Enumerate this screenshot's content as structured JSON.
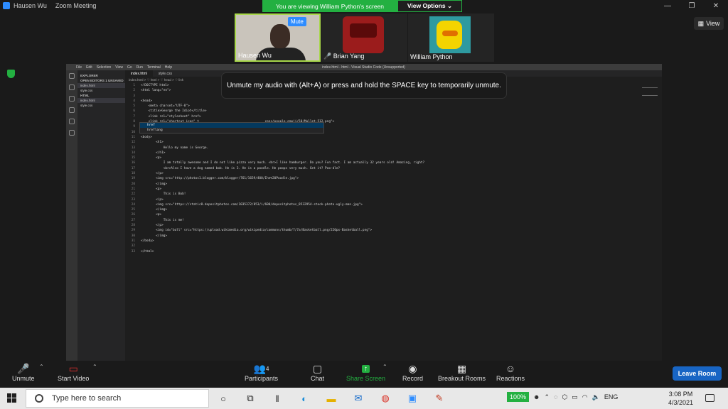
{
  "titlebar": {
    "user": "Hausen Wu",
    "app": "Zoom Meeting"
  },
  "banner": {
    "viewing": "You are viewing William Python's screen",
    "options": "View Options ⌄"
  },
  "view_button": "View",
  "participants": [
    {
      "name": "Hausen Wu",
      "mute_label": "Mute"
    },
    {
      "name": "Brian Yang"
    },
    {
      "name": "William Python"
    }
  ],
  "vscode": {
    "window_title": "index.html - html - Visual Studio Code (Unsupported)",
    "menu": [
      "File",
      "Edit",
      "Selection",
      "View",
      "Go",
      "Run",
      "Terminal",
      "Help"
    ],
    "explorer_label": "EXPLORER",
    "open_editors_label": "OPEN EDITORS",
    "unsaved_badge": "1 UNSAVED",
    "open_files": [
      "index.html",
      "style.css"
    ],
    "folder_label": "HTML",
    "folder_files": [
      "index.html",
      "style.css"
    ],
    "tabs": [
      "index.html",
      "style.css"
    ],
    "breadcrumb": "index.html > ♡ html > ♡ head > ♡ link",
    "code_lines": [
      {
        "n": "1",
        "t": "<!DOCTYPE html>"
      },
      {
        "n": "2",
        "t": "<html lang=\"en\">"
      },
      {
        "n": "3",
        "t": ""
      },
      {
        "n": "4",
        "t": "<head>"
      },
      {
        "n": "5",
        "t": "    <meta charset=\"UTF-8\">"
      },
      {
        "n": "6",
        "t": "    <title>George the Idiot</title>"
      },
      {
        "n": "7",
        "t": "    <link rel=\"stylesheet\" href>"
      },
      {
        "n": "8",
        "t": "    <link rel=\"shortcut icon\" t                                   cons/people-emoji/50/Mullet-512.png\">"
      },
      {
        "n": "9",
        "t": "</head>"
      },
      {
        "n": "10",
        "t": ""
      },
      {
        "n": "11",
        "t": "<body>"
      },
      {
        "n": "12",
        "t": "        <h1>"
      },
      {
        "n": "13",
        "t": "            Hello my name is George."
      },
      {
        "n": "14",
        "t": "        </h1>"
      },
      {
        "n": "15",
        "t": "        <p>"
      },
      {
        "n": "16",
        "t": "            I am totally awesome and I do not like pizza very much. <br>I like hamburger. Do you? Fun fact. I am actually 32 years old! Amazing, right?"
      },
      {
        "n": "17",
        "t": "            <br>Also I have a dog named bob. He is 3. He is a poodle. He poops very much. Get it? Poo-dle?"
      },
      {
        "n": "18",
        "t": "        </p>"
      },
      {
        "n": "19",
        "t": "        <img src=\"http://photos1.blogger.com/blogger/761/1659/400/Ihe%20Poodle.jpg\">"
      },
      {
        "n": "20",
        "t": "        </img>"
      },
      {
        "n": "21",
        "t": "        <p>"
      },
      {
        "n": "22",
        "t": "            This is Bob!"
      },
      {
        "n": "23",
        "t": "        </p>"
      },
      {
        "n": "24",
        "t": "        <img src=\"https://static8.depositphotos.com/1035372/853/i/600/depositphotos_8532954-stock-photo-ugly-man.jpg\">"
      },
      {
        "n": "25",
        "t": "        </img>"
      },
      {
        "n": "26",
        "t": "        <p>"
      },
      {
        "n": "27",
        "t": "            This is me!"
      },
      {
        "n": "28",
        "t": "        </p>"
      },
      {
        "n": "29",
        "t": "        <img id=\"ball\" src=\"https://upload.wikimedia.org/wikipedia/commons/thumb/7/7a/Basketball.png/220px-Basketball.png\">"
      },
      {
        "n": "30",
        "t": "        </img>"
      },
      {
        "n": "31",
        "t": "</body>"
      },
      {
        "n": "32",
        "t": ""
      },
      {
        "n": "33",
        "t": "</html>"
      }
    ],
    "suggestions": [
      "href",
      "hreflang"
    ]
  },
  "tooltip": "Unmute my audio with (Alt+A) or press and hold the SPACE key to temporarily unmute.",
  "toolbar": {
    "unmute": "Unmute",
    "start_video": "Start Video",
    "participants": "Participants",
    "participant_count": "4",
    "chat": "Chat",
    "share_screen": "Share Screen",
    "record": "Record",
    "breakout": "Breakout Rooms",
    "reactions": "Reactions",
    "leave": "Leave Room"
  },
  "taskbar": {
    "search_placeholder": "Type here to search",
    "battery_pct": "100%",
    "lang": "ENG",
    "time": "3:08 PM",
    "date": "4/3/2021"
  },
  "colors": {
    "zoom_blue": "#2d8cff",
    "share_green": "#23b041",
    "leave_blue": "#1865c4"
  }
}
